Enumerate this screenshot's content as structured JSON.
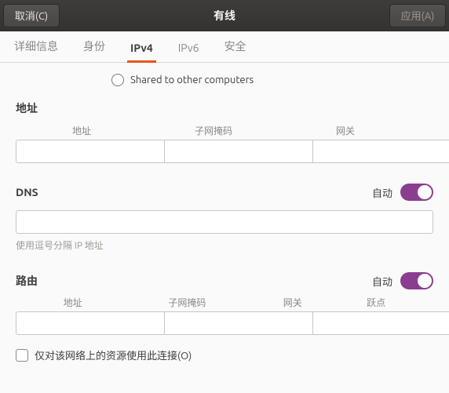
{
  "titlebar": {
    "cancel": "取消(C)",
    "title": "有线",
    "apply": "应用(A)"
  },
  "tabs": {
    "details": "详细信息",
    "identity": "身份",
    "ipv4": "IPv4",
    "ipv6": "IPv6",
    "security": "安全"
  },
  "shared_radio_label": "Shared to other computers",
  "addresses": {
    "section_label": "地址",
    "col_address": "地址",
    "col_netmask": "子网掩码",
    "col_gateway": "网关"
  },
  "dns": {
    "section_label": "DNS",
    "auto_label": "自动",
    "hint": "使用逗号分隔 IP 地址"
  },
  "routes": {
    "section_label": "路由",
    "auto_label": "自动",
    "col_address": "地址",
    "col_netmask": "子网掩码",
    "col_gateway": "网关",
    "col_metric": "跃点"
  },
  "only_this_network_label": "仅对该网络上的资源使用此连接(O)"
}
